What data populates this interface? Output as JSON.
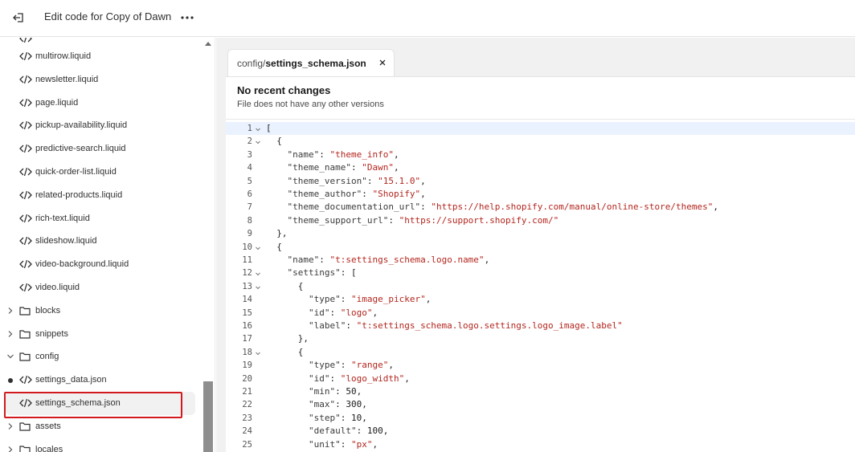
{
  "topbar": {
    "title": "Edit code for Copy of Dawn",
    "exit_icon": "exit-icon",
    "more_icon": "more-horizontal-icon"
  },
  "sidebar": {
    "files_top": [
      "multirow.liquid",
      "newsletter.liquid",
      "page.liquid",
      "pickup-availability.liquid",
      "predictive-search.liquid",
      "quick-order-list.liquid",
      "related-products.liquid",
      "rich-text.liquid",
      "slideshow.liquid",
      "video-background.liquid",
      "video.liquid"
    ],
    "folders_a": [
      "blocks",
      "snippets"
    ],
    "config_folder": "config",
    "config_files": [
      "settings_data.json",
      "settings_schema.json"
    ],
    "folders_b": [
      "assets",
      "locales"
    ],
    "selected_file": "settings_schema.json",
    "modified_file": "settings_data.json"
  },
  "editor": {
    "tab": {
      "dir": "config/",
      "file": "settings_schema.json"
    },
    "changes_title": "No recent changes",
    "changes_sub": "File does not have any other versions",
    "lines": [
      "[",
      "  {",
      "    \"name\": \"theme_info\",",
      "    \"theme_name\": \"Dawn\",",
      "    \"theme_version\": \"15.1.0\",",
      "    \"theme_author\": \"Shopify\",",
      "    \"theme_documentation_url\": \"https://help.shopify.com/manual/online-store/themes\",",
      "    \"theme_support_url\": \"https://support.shopify.com/\"",
      "  },",
      "  {",
      "    \"name\": \"t:settings_schema.logo.name\",",
      "    \"settings\": [",
      "      {",
      "        \"type\": \"image_picker\",",
      "        \"id\": \"logo\",",
      "        \"label\": \"t:settings_schema.logo.settings.logo_image.label\"",
      "      },",
      "      {",
      "        \"type\": \"range\",",
      "        \"id\": \"logo_width\",",
      "        \"min\": 50,",
      "        \"max\": 300,",
      "        \"step\": 10,",
      "        \"default\": 100,",
      "        \"unit\": \"px\","
    ],
    "fold_lines": [
      1,
      2,
      10,
      12,
      13,
      18
    ]
  }
}
